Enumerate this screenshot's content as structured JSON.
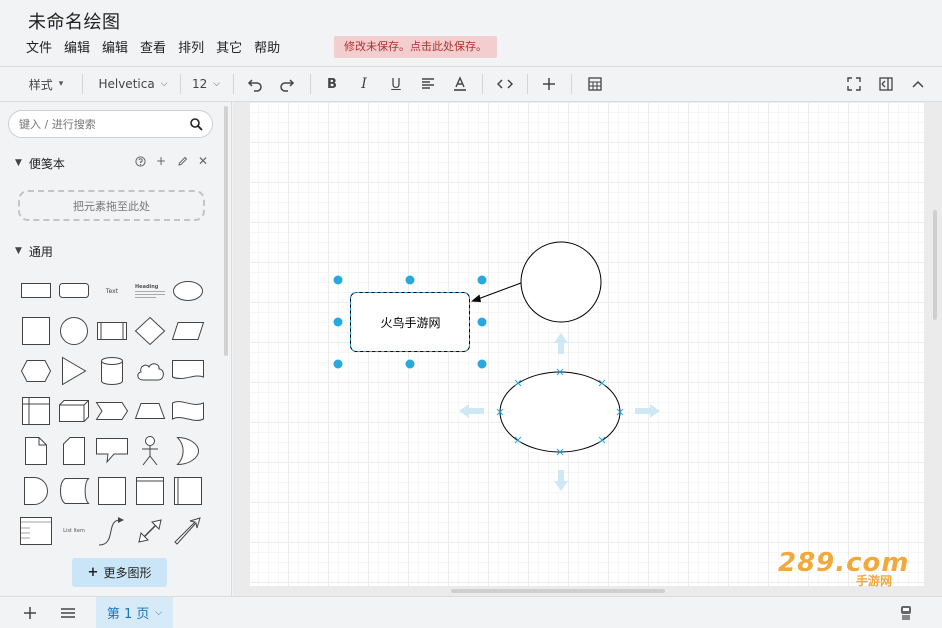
{
  "title": "未命名绘图",
  "menus": [
    "文件",
    "编辑",
    "编辑",
    "查看",
    "排列",
    "其它",
    "帮助"
  ],
  "unsaved_notice": "修改未保存。点击此处保存。",
  "toolbar": {
    "style_label": "样式",
    "font_family": "Helvetica",
    "font_size": "12",
    "icons": [
      "undo-icon",
      "redo-icon",
      "bold-icon",
      "italic-icon",
      "underline-icon",
      "align-icon",
      "font-color-icon",
      "code-icon",
      "add-icon",
      "table-icon",
      "fullscreen-icon",
      "format-panel-icon",
      "collapse-icon"
    ]
  },
  "sidebar": {
    "search_placeholder": "键入 / 进行搜索",
    "scratchpad": {
      "title": "便笺本",
      "dropzone": "把元素拖至此处"
    },
    "general": {
      "title": "通用",
      "text_shape": "Text",
      "heading_shape": "Heading",
      "list_shape": "List Item"
    },
    "more_shapes": "更多图形"
  },
  "diagram": {
    "selected_box_label": "火鸟手游网"
  },
  "bottom": {
    "page_tab": "第 1 页"
  },
  "watermark": {
    "main": "289.com",
    "sub": "手游网"
  },
  "colors": {
    "accent": "#29a8e0",
    "unsaved_bg": "#f3cece",
    "unsaved_text": "#b03030",
    "page_tab_bg": "#d6eaf8",
    "more_button_bg": "#c9e5f7"
  }
}
